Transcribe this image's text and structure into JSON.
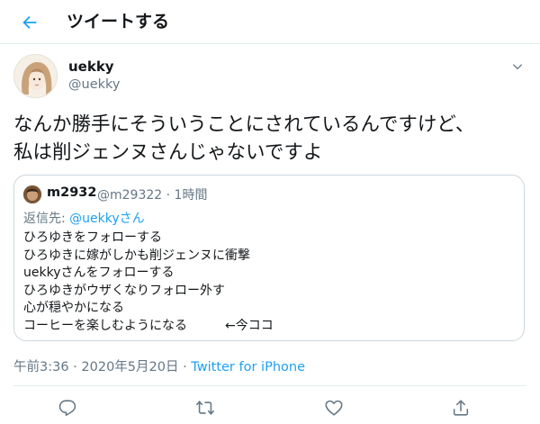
{
  "header": {
    "back_icon": "arrow-left-icon",
    "title": "ツイートする"
  },
  "tweet": {
    "author": {
      "display_name": "uekky",
      "handle": "@uekky"
    },
    "menu_icon": "chevron-down-icon",
    "text_lines": [
      "なんか勝手にそういうことにされているんですけど、",
      "私は削ジェンヌさんじゃないですよ"
    ],
    "quote": {
      "display_name": "m2932",
      "handle": "@m29322",
      "separator": "·",
      "time_ago": "1時間",
      "reply_prefix": "返信先: ",
      "reply_mention": "@uekkyさん",
      "lines": [
        "ひろゆきをフォローする",
        "ひろゆきに嫁がしかも削ジェンヌに衝撃",
        "uekkyさんをフォローする",
        "ひろゆきがウザくなりフォロー外す",
        "心が穏やかになる",
        "コーヒーを楽しむようになる　　　←今ココ"
      ]
    },
    "timestamp": "午前3:36 · 2020年5月20日 · ",
    "source": "Twitter for iPhone"
  },
  "actions": [
    {
      "name": "reply",
      "icon": "reply-icon"
    },
    {
      "name": "retweet",
      "icon": "retweet-icon"
    },
    {
      "name": "like",
      "icon": "heart-icon"
    },
    {
      "name": "share",
      "icon": "share-icon"
    }
  ],
  "colors": {
    "accent": "#1da1f2",
    "secondary_text": "#657786",
    "primary_text": "#14171a",
    "border": "#ccd6dd"
  }
}
